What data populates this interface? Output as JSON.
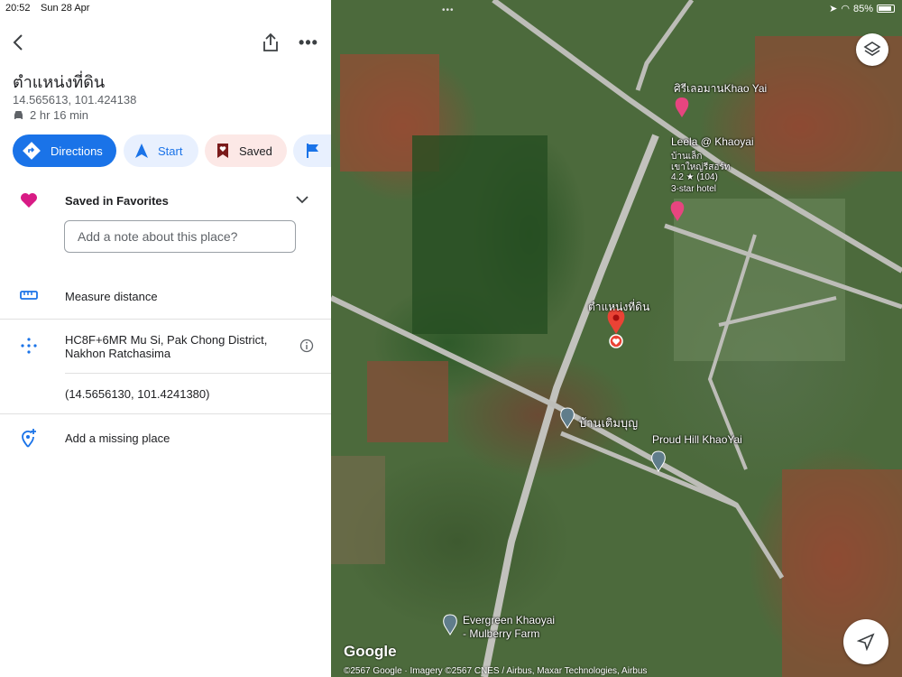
{
  "status": {
    "time": "20:52",
    "date": "Sun 28 Apr",
    "battery": "85%"
  },
  "place": {
    "title": "ตำแหน่งที่ดิน",
    "coordinates": "14.565613, 101.424138",
    "drive_time": "2 hr 16 min"
  },
  "actions": {
    "directions": "Directions",
    "start": "Start",
    "saved": "Saved"
  },
  "saved": {
    "label": "Saved in Favorites",
    "note_placeholder": "Add a note about this place?"
  },
  "rows": {
    "measure": "Measure distance",
    "address_line1": "HC8F+6MR Mu Si, Pak Chong District,",
    "address_line2": "Nakhon Ratchasima",
    "precise_coords": "(14.5656130, 101.4241380)",
    "add_missing": "Add a missing place"
  },
  "map": {
    "labels": {
      "resort1": "ศิรีเลอมานKhao Yai",
      "leela": "Leela @ Khaoyai",
      "leela_sub1": "บ้านเล็ก",
      "leela_sub2": "เขาใหญ่รีสอร์ท",
      "leela_rating": "4.2 ★ (104)",
      "leela_class": "3-star hotel",
      "pin": "ตำแหน่งที่ดิน",
      "baan": "บ้านเติมบุญ",
      "proud": "Proud Hill KhaoYai",
      "evergreen1": "Evergreen Khaoyai",
      "evergreen2": "- Mulberry Farm"
    },
    "logo": "Google",
    "attribution": "©2567 Google · Imagery ©2567 CNES / Airbus, Maxar Technologies, Airbus"
  },
  "colors": {
    "accent": "#1a73e8",
    "favorite": "#d81b85",
    "pin": "#ea4335"
  }
}
